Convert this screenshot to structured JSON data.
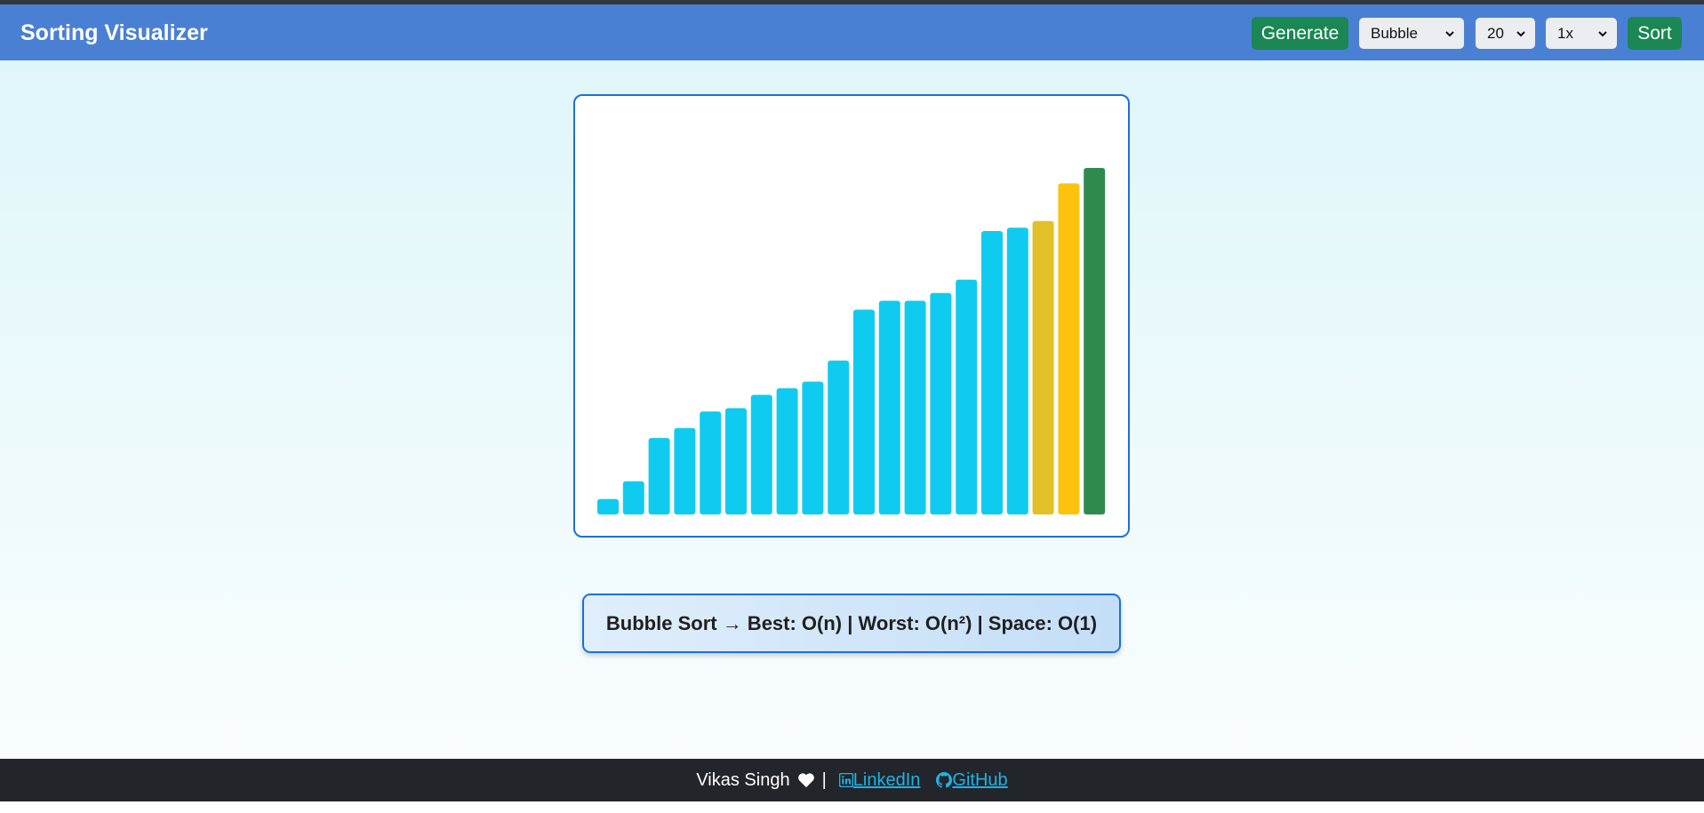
{
  "app": {
    "title": "Sorting Visualizer"
  },
  "toolbar": {
    "generate_label": "Generate",
    "algorithm_value": "Bubble",
    "size_value": "20",
    "speed_value": "1x",
    "sort_label": "Sort"
  },
  "colors": {
    "navbar": "#4a80d4",
    "bar_default": "#0fcbf0",
    "bar_compare": "#e2c128",
    "bar_swap": "#fcc20e",
    "bar_sorted": "#2e8b4e",
    "button_green": "#1a8754"
  },
  "bars": {
    "values": [
      14,
      30,
      69,
      78,
      93,
      96,
      108,
      114,
      120,
      139,
      185,
      193,
      193,
      200,
      212,
      256,
      259,
      265,
      299,
      313
    ],
    "states": [
      "default",
      "default",
      "default",
      "default",
      "default",
      "default",
      "default",
      "default",
      "default",
      "default",
      "default",
      "default",
      "default",
      "default",
      "default",
      "default",
      "default",
      "compare",
      "swap",
      "sorted"
    ]
  },
  "info": {
    "text": "Bubble Sort → Best: O(n) | Worst: O(n²) | Space: O(1)"
  },
  "footer": {
    "author": "Vikas Singh",
    "separator": "|",
    "linkedin_label": " LinkedIn",
    "github_label": " GitHub",
    "icons": [
      "heart-icon",
      "linkedin-icon",
      "github-icon"
    ]
  }
}
